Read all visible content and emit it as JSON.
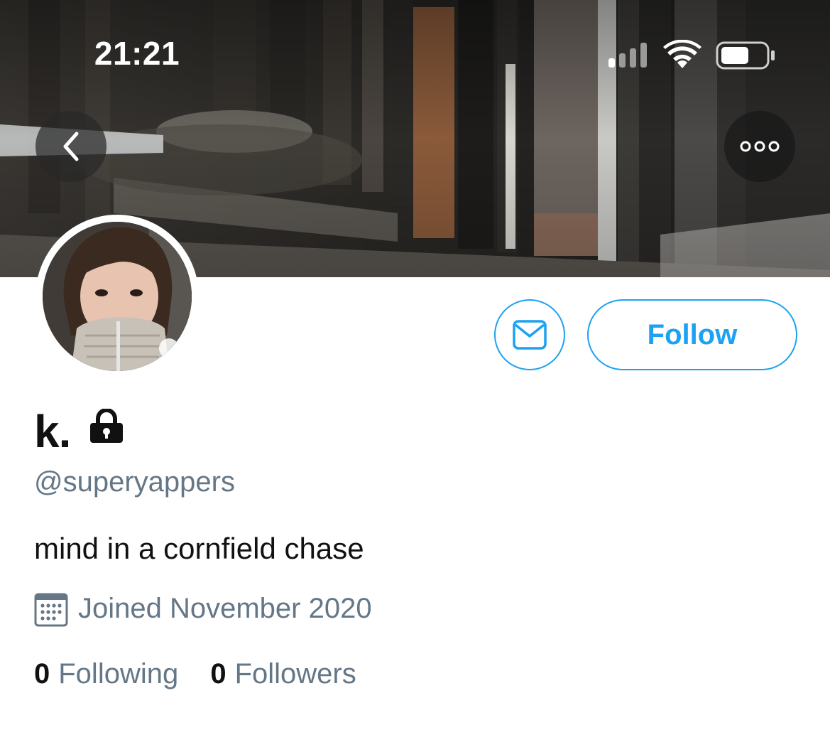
{
  "status_bar": {
    "time": "21:21",
    "signal_icon": "cellular-signal-icon",
    "wifi_icon": "wifi-icon",
    "battery_icon": "battery-icon"
  },
  "header": {
    "back_icon": "chevron-left-icon",
    "more_icon": "more-horizontal-icon"
  },
  "actions": {
    "message_icon": "envelope-icon",
    "follow_label": "Follow"
  },
  "profile": {
    "display_name": "k.",
    "protected_icon": "lock-icon",
    "handle": "@superyappers",
    "bio": "mind in a cornfield chase",
    "joined_icon": "calendar-icon",
    "joined": "Joined November 2020"
  },
  "stats": {
    "following_count": "0",
    "following_label": "Following",
    "followers_count": "0",
    "followers_label": "Followers"
  },
  "colors": {
    "accent": "#1da1f2",
    "secondary_text": "#657786",
    "primary_text": "#111111"
  }
}
